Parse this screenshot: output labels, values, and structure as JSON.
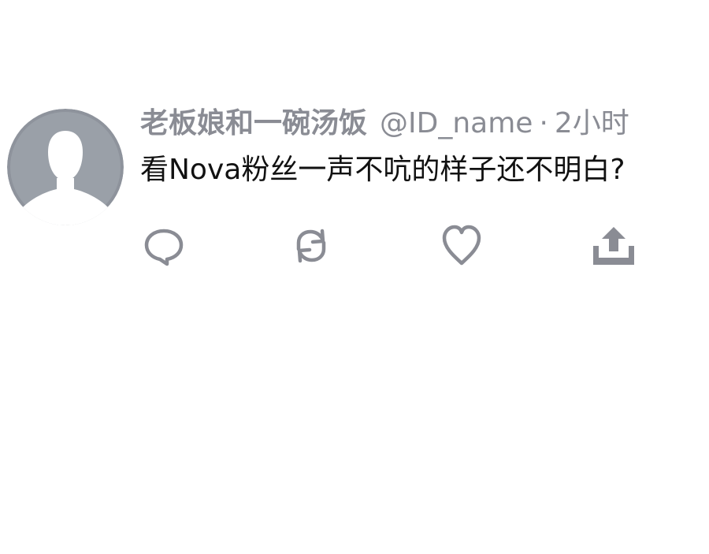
{
  "tweet": {
    "display_name": "老板娘和一碗汤饭",
    "handle": "@ID_name",
    "separator": "·",
    "time": "2小时",
    "text": "看Nova粉丝一声不吭的样子还不明白?"
  },
  "actions": {
    "reply_icon": "comment-bubble-icon",
    "retweet_icon": "retweet-arrows-icon",
    "like_icon": "heart-icon",
    "share_icon": "share-upload-icon"
  },
  "colors": {
    "muted_text": "#8a8c94",
    "body_text": "#111111",
    "avatar_bg": "#8e939c",
    "icon": "#8a8c94"
  }
}
